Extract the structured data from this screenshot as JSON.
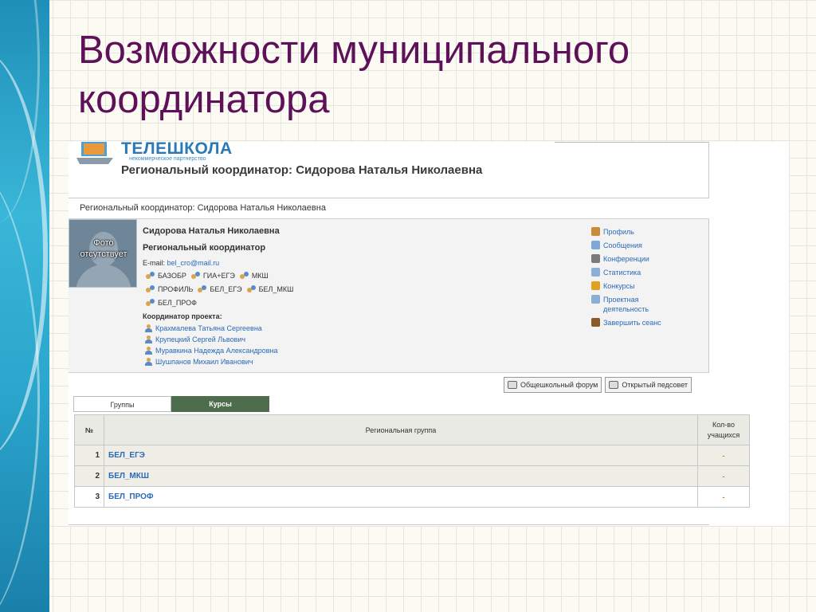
{
  "slide": {
    "title": "Возможности муниципального координатора"
  },
  "header": {
    "logo_text": "ТЕЛЕШКОЛА",
    "logo_subtitle": "некоммерческое партнерство",
    "title": "Региональный координатор: Сидорова Наталья Николаевна"
  },
  "breadcrumb": "Региональный координатор: Сидорова Наталья Николаевна",
  "profile": {
    "photo_text": "Фото отсутствует",
    "name": "Сидорова Наталья Николаевна",
    "role": "Региональный координатор",
    "email_label": "E-mail:",
    "email": "bel_cro@mail.ru",
    "groups_row1": [
      "БАЗОБР",
      "ГИА+ЕГЭ",
      "МКШ"
    ],
    "groups_row2": [
      "ПРОФИЛЬ",
      "БЕЛ_ЕГЭ",
      "БЕЛ_МКШ"
    ],
    "groups_row3": [
      "БЕЛ_ПРОФ"
    ],
    "coordinators_title": "Координатор проекта:",
    "coordinators": [
      "Крахмалева Татьяна Сергеевна",
      "Крупецкий Сергей Львович",
      "Муравкина Надежда Александровна",
      "Шушпанов Михаил Иванович"
    ]
  },
  "menu": [
    {
      "label": "Профиль",
      "icon": "profile-icon",
      "color": "#c98a3a"
    },
    {
      "label": "Сообщения",
      "icon": "envelope-icon",
      "color": "#7fa8d8"
    },
    {
      "label": "Конференции",
      "icon": "conference-icon",
      "color": "#7a7a7a"
    },
    {
      "label": "Статистика",
      "icon": "document-icon",
      "color": "#8ab0d8"
    },
    {
      "label": "Конкурсы",
      "icon": "medal-icon",
      "color": "#e0a020"
    },
    {
      "label": "Проектная деятельность",
      "icon": "page-icon",
      "color": "#8ab0d8"
    },
    {
      "label": "Завершить сеанс",
      "icon": "door-icon",
      "color": "#8a5a2a"
    }
  ],
  "buttons": {
    "forum": "Общешкольный форум",
    "council": "Открытый педсовет"
  },
  "tabs": [
    "Группы",
    "Курсы"
  ],
  "table": {
    "headers": [
      "№",
      "Региональная группа",
      "Кол-во учащихся"
    ],
    "rows": [
      {
        "n": "1",
        "group": "БЕЛ_ЕГЭ",
        "count": "-"
      },
      {
        "n": "2",
        "group": "БЕЛ_МКШ",
        "count": "-"
      },
      {
        "n": "3",
        "group": "БЕЛ_ПРОФ",
        "count": "-"
      }
    ]
  }
}
